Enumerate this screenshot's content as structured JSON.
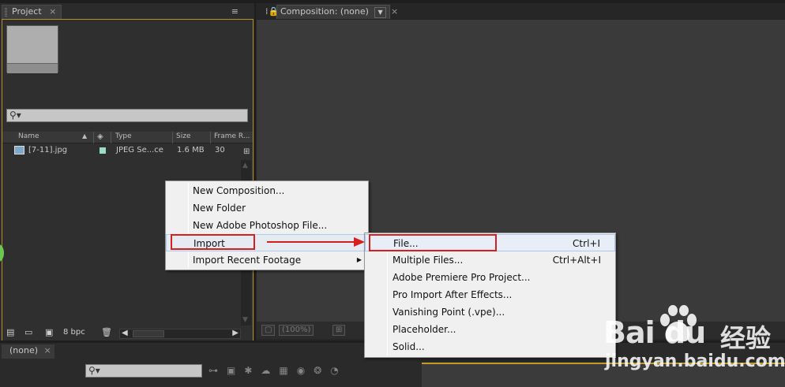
{
  "project_panel": {
    "tab_label": "Project",
    "tab_close": "×",
    "menu_icon": "≡",
    "search_placeholder": "",
    "columns": [
      "Name",
      "Type",
      "Size",
      "Frame R..."
    ],
    "files": [
      {
        "name": "[7-11].jpg",
        "type": "JPEG Se...ce",
        "size": "1.6 MB",
        "frame_rate": "30",
        "label_color": "#9fd9c9"
      }
    ],
    "bpc_label": "8 bpc"
  },
  "composition_panel": {
    "tab_label": "Composition: (none)",
    "tab_close": "×",
    "zoom_label": "(100%)"
  },
  "timeline_panel": {
    "tab_label": "(none)",
    "tab_close": "×"
  },
  "context_menu": {
    "items": [
      {
        "label": "New Composition..."
      },
      {
        "label": "New Folder"
      },
      {
        "label": "New Adobe Photoshop File..."
      },
      {
        "label": "Import",
        "arrow": "▶"
      },
      {
        "label": "Import Recent Footage",
        "arrow": "▶"
      }
    ]
  },
  "import_submenu": {
    "items": [
      {
        "label": "File...",
        "shortcut": "Ctrl+I"
      },
      {
        "label": "Multiple Files...",
        "shortcut": "Ctrl+Alt+I"
      },
      {
        "label": "Adobe Premiere Pro Project..."
      },
      {
        "label": "Pro Import After Effects..."
      },
      {
        "label": "Vanishing Point (.vpe)..."
      },
      {
        "label": "Placeholder..."
      },
      {
        "label": "Solid..."
      }
    ]
  },
  "watermark": {
    "brand": "Bai du",
    "chinese": "经验",
    "url": "jingyan.baidu.com"
  },
  "annotation_color": "#d81e1e"
}
